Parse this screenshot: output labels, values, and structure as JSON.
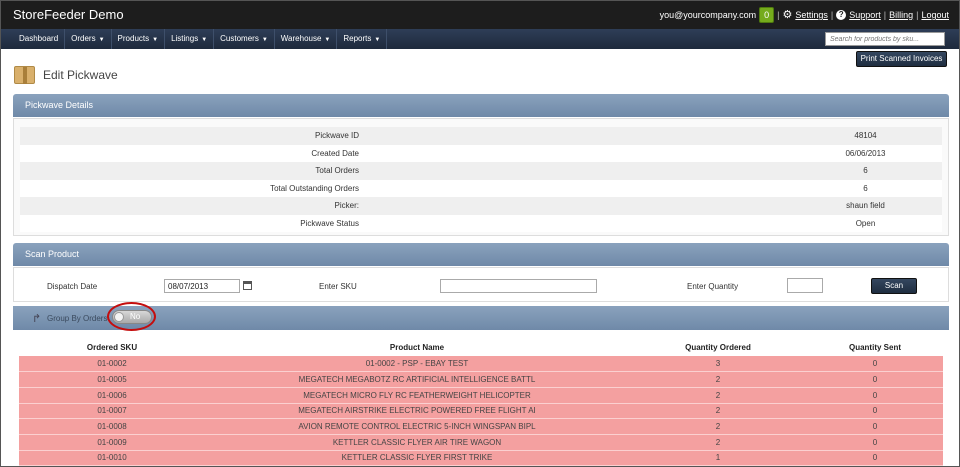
{
  "app": {
    "title": "StoreFeeder Demo",
    "user_email": "you@yourcompany.com",
    "notification_count": "0",
    "settings_label": "Settings",
    "support_label": "Support",
    "billing_label": "Billing",
    "logout_label": "Logout",
    "separator": "|"
  },
  "nav": {
    "items": [
      {
        "label": "Dashboard",
        "dropdown": false
      },
      {
        "label": "Orders",
        "dropdown": true
      },
      {
        "label": "Products",
        "dropdown": true
      },
      {
        "label": "Listings",
        "dropdown": true
      },
      {
        "label": "Customers",
        "dropdown": true
      },
      {
        "label": "Warehouse",
        "dropdown": true
      },
      {
        "label": "Reports",
        "dropdown": true
      }
    ],
    "search_placeholder": "Search for products by sku..."
  },
  "toolbar": {
    "print_label": "Print Scanned Invoices"
  },
  "page": {
    "title": "Edit Pickwave"
  },
  "details": {
    "header": "Pickwave Details",
    "rows": [
      {
        "label": "Pickwave ID",
        "value": "48104"
      },
      {
        "label": "Created Date",
        "value": "06/06/2013"
      },
      {
        "label": "Total Orders",
        "value": "6"
      },
      {
        "label": "Total Outstanding Orders",
        "value": "6"
      },
      {
        "label": "Picker:",
        "value": "shaun field"
      },
      {
        "label": "Pickwave Status",
        "value": "Open"
      }
    ]
  },
  "scan": {
    "header": "Scan Product",
    "dispatch_label": "Dispatch Date",
    "dispatch_value": "08/07/2013",
    "sku_label": "Enter SKU",
    "sku_value": "",
    "quantity_label": "Enter Quantity",
    "quantity_value": "",
    "scan_button": "Scan"
  },
  "group": {
    "label": "Group By Orders",
    "toggle_value": "No"
  },
  "table": {
    "headers": [
      "Ordered SKU",
      "Product Name",
      "Quantity Ordered",
      "Quantity Sent"
    ],
    "rows": [
      [
        "01-0002",
        "01-0002 - PSP - EBAY TEST",
        "3",
        "0"
      ],
      [
        "01-0005",
        "MEGATECH MEGABOTZ RC ARTIFICIAL INTELLIGENCE BATTL",
        "2",
        "0"
      ],
      [
        "01-0006",
        "MEGATECH MICRO FLY RC FEATHERWEIGHT HELICOPTER",
        "2",
        "0"
      ],
      [
        "01-0007",
        "MEGATECH AIRSTRIKE ELECTRIC POWERED FREE FLIGHT AI",
        "2",
        "0"
      ],
      [
        "01-0008",
        "AVION REMOTE CONTROL ELECTRIC 5-INCH WINGSPAN BIPL",
        "2",
        "0"
      ],
      [
        "01-0009",
        "KETTLER CLASSIC FLYER AIR TIRE WAGON",
        "2",
        "0"
      ],
      [
        "01-0010",
        "KETTLER CLASSIC FLYER FIRST TRIKE",
        "1",
        "0"
      ]
    ]
  },
  "colors": {
    "topbar": "#1d1d1d",
    "navbar": "#243246",
    "panel_header": "#7b94b2",
    "row_highlight": "#f4a0a0",
    "badge": "#75ab1c",
    "annotation_ring": "#c40d0d"
  }
}
